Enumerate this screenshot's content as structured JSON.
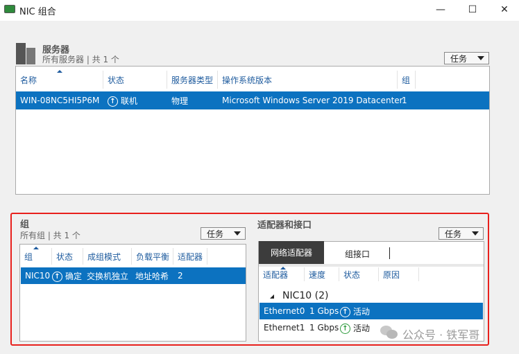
{
  "window": {
    "title": "NIC 组合",
    "minimize": "—",
    "maximize": "☐",
    "close": "✕"
  },
  "servers": {
    "title": "服务器",
    "subtitle": "所有服务器 | 共 1 个",
    "tasks": "任务",
    "columns": [
      "名称",
      "状态",
      "服务器类型",
      "操作系统版本",
      "组"
    ],
    "rows": [
      {
        "name": "WIN-08NC5HI5P6M",
        "status": "联机",
        "type": "物理",
        "os": "Microsoft Windows Server 2019 Datacenter",
        "group": "1"
      }
    ]
  },
  "teams": {
    "title": "组",
    "subtitle": "所有组 | 共 1 个",
    "tasks": "任务",
    "columns": [
      "组",
      "状态",
      "成组模式",
      "负载平衡",
      "适配器"
    ],
    "rows": [
      {
        "team": "NIC10",
        "status": "确定",
        "mode": "交换机独立",
        "lb": "地址哈希",
        "adapters": "2"
      }
    ]
  },
  "adapters": {
    "title": "适配器和接口",
    "tasks": "任务",
    "tabs": [
      "网络适配器",
      "组接口"
    ],
    "columns": [
      "适配器",
      "速度",
      "状态",
      "原因"
    ],
    "group": "NIC10 (2)",
    "rows": [
      {
        "name": "Ethernet0",
        "speed": "1 Gbps",
        "status": "活动"
      },
      {
        "name": "Ethernet1",
        "speed": "1 Gbps",
        "status": "活动"
      }
    ]
  },
  "watermark": "公众号 · 铁军哥",
  "colors": {
    "accent": "#0c72c0",
    "highlight_border": "#e8201c",
    "active_green": "#2a9a3a"
  }
}
